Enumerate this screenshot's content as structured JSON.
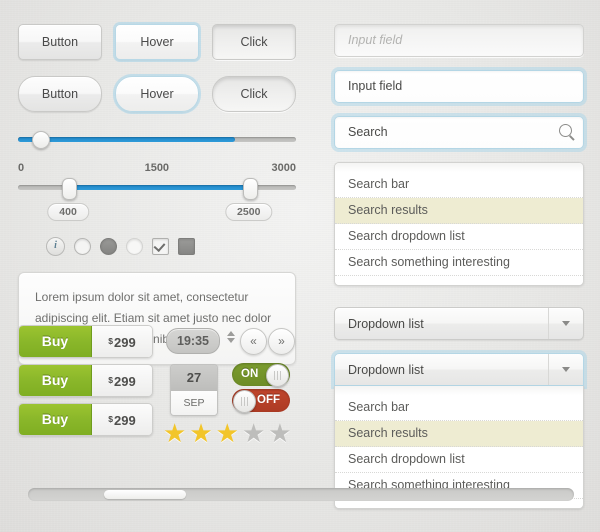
{
  "buttons": {
    "row1": [
      {
        "label": "Button",
        "state": "normal"
      },
      {
        "label": "Hover",
        "state": "hover"
      },
      {
        "label": "Click",
        "state": "click"
      }
    ],
    "row2": [
      {
        "label": "Button",
        "state": "normal"
      },
      {
        "label": "Hover",
        "state": "hover"
      },
      {
        "label": "Click",
        "state": "click"
      }
    ]
  },
  "slider_single": {
    "value_percent": 8,
    "fill_percent": 78
  },
  "slider_range": {
    "tick_min": "0",
    "tick_mid": "1500",
    "tick_max": "3000",
    "handle_low_label": "400",
    "handle_high_label": "2500",
    "handle_low_percent": 18,
    "handle_high_percent": 83
  },
  "controls": {
    "info_icon": "i",
    "radio_empty": "radio-unselected",
    "radio_filled": "radio-selected",
    "radio_light": "radio-disabled",
    "checkbox_checked": "checkbox-checked",
    "checkbox_solid": "checkbox-solid"
  },
  "tooltip": {
    "text": "Lorem ipsum dolor sit amet, consectetur adipiscing elit. Etiam sit amet justo nec dolor mattis commodo et at nibh."
  },
  "buy_buttons": [
    {
      "label": "Buy",
      "currency": "$",
      "price": "299"
    },
    {
      "label": "Buy",
      "currency": "$",
      "price": "299"
    },
    {
      "label": "Buy",
      "currency": "$",
      "price": "299"
    }
  ],
  "time_widget": {
    "value": "19:35"
  },
  "nav": {
    "prev": "«",
    "next": "»"
  },
  "date_widget": {
    "day": "27",
    "month": "SEP"
  },
  "toggles": [
    {
      "label": "ON",
      "state": "on"
    },
    {
      "label": "OFF",
      "state": "off"
    }
  ],
  "rating": {
    "filled": 3,
    "total": 5,
    "glyph": "★"
  },
  "inputs": {
    "field_placeholder": {
      "placeholder": "Input field"
    },
    "field_filled": {
      "value": "Input field"
    },
    "search": {
      "value": "Search",
      "icon": "search-icon"
    }
  },
  "search_results": {
    "items": [
      "Search bar",
      "Search results",
      "Search dropdown list",
      "Search something interesting"
    ],
    "selected_index": 1
  },
  "dropdown_closed": {
    "label": "Dropdown list"
  },
  "dropdown_open": {
    "label": "Dropdown list"
  },
  "dropdown_items": {
    "items": [
      "Search bar",
      "Search results",
      "Search dropdown list",
      "Search something interesting"
    ],
    "selected_index": 1
  },
  "scrollbar": {
    "thumb_left_percent": 14,
    "thumb_width_percent": 15
  },
  "colors": {
    "accent_blue": "#2a8fd0",
    "buy_green": "#8ab72a",
    "toggle_on": "#7b9c2e",
    "toggle_off": "#c0452c",
    "star_gold": "#f2c52a",
    "highlight": "#eeecd2"
  }
}
